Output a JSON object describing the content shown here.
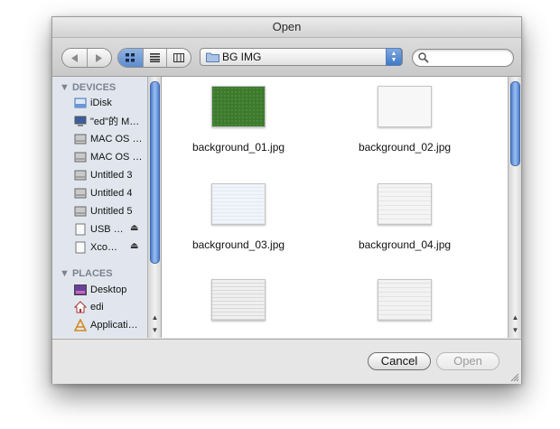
{
  "window": {
    "title": "Open"
  },
  "toolbar": {
    "back_icon": "back-arrow-icon",
    "forward_icon": "forward-arrow-icon",
    "views": [
      "icon-view-icon",
      "list-view-icon",
      "column-view-icon"
    ],
    "selected_view": "icon-view-icon",
    "location": "BG IMG",
    "search_value": ""
  },
  "sidebar": {
    "devices_header": "DEVICES",
    "devices": [
      {
        "label": "iDisk",
        "icon": "idisk-icon"
      },
      {
        "label": "\"ed\"的 M…",
        "icon": "computer-icon"
      },
      {
        "label": "MAC OS …",
        "icon": "hard-drive-icon"
      },
      {
        "label": "MAC OS …",
        "icon": "hard-drive-icon"
      },
      {
        "label": "Untitled 3",
        "icon": "hard-drive-icon"
      },
      {
        "label": "Untitled 4",
        "icon": "hard-drive-icon"
      },
      {
        "label": "Untitled 5",
        "icon": "hard-drive-icon"
      },
      {
        "label": "USB …",
        "icon": "usb-drive-icon",
        "eject": true
      },
      {
        "label": "Xco…",
        "icon": "disk-image-icon",
        "eject": true
      }
    ],
    "places_header": "PLACES",
    "places": [
      {
        "label": "Desktop",
        "icon": "desktop-icon"
      },
      {
        "label": "edi",
        "icon": "home-icon"
      },
      {
        "label": "Applicati…",
        "icon": "applications-icon"
      }
    ]
  },
  "files": [
    {
      "name": "background_01.jpg",
      "thumb_color": "#3d7a2e"
    },
    {
      "name": "background_02.jpg",
      "thumb_color": "#f7f7f7"
    },
    {
      "name": "background_03.jpg",
      "thumb_color": "#f1f4fa"
    },
    {
      "name": "background_04.jpg",
      "thumb_color": "#f4f4f4"
    },
    {
      "name": "",
      "thumb_color": "#efefef"
    },
    {
      "name": "",
      "thumb_color": "#f2f2f2"
    }
  ],
  "buttons": {
    "cancel": "Cancel",
    "open": "Open"
  }
}
